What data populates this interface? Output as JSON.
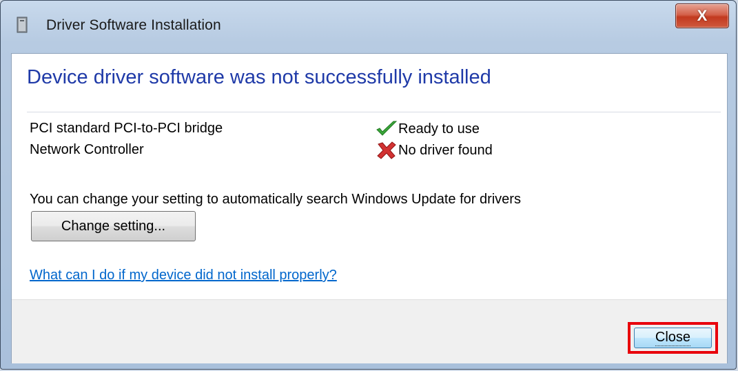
{
  "window": {
    "title": "Driver Software Installation",
    "close_glyph": "X"
  },
  "dialog": {
    "heading": "Device driver software was not successfully installed",
    "devices": [
      {
        "name": "PCI standard PCI-to-PCI bridge",
        "status": "Ready to use",
        "icon": "checkmark-icon"
      },
      {
        "name": "Network Controller",
        "status": "No driver found",
        "icon": "x-mark-icon"
      }
    ],
    "info_text": "You can change your setting to automatically search Windows Update for drivers",
    "change_button_label": "Change setting...",
    "help_link": "What can I do if my device did not install properly?",
    "close_button_label": "Close"
  },
  "colors": {
    "heading": "#1f3aa8",
    "link": "#0066cc",
    "highlight": "#e8000b"
  }
}
